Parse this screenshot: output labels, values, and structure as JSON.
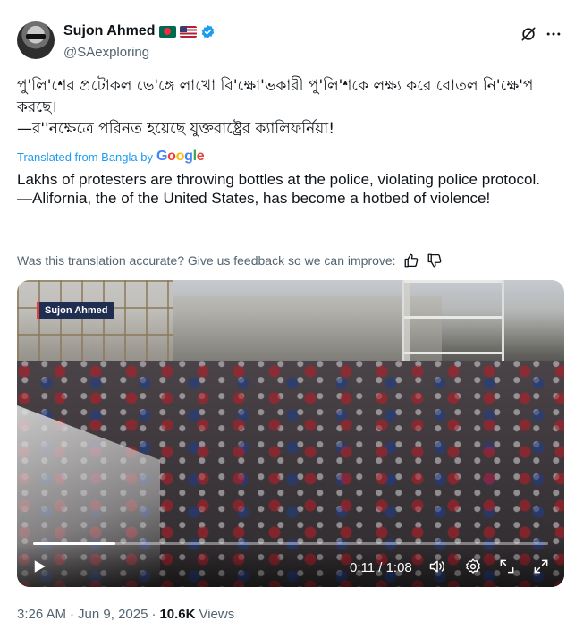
{
  "author": {
    "display_name": "Sujon Ahmed",
    "handle": "@SAexploring",
    "verified": true,
    "flags": [
      "bangladesh-flag",
      "us-flag"
    ]
  },
  "post": {
    "original_line1": "পু'লি'শের প্রটোকল ভে'ঙ্গে লাখো বি'ক্ষো'ভকারী পু'লি'শকে লক্ষ্য করে বোতল নি'ক্ষে'প করছে।",
    "original_line2": "—র''নক্ষেত্রে পরিনত হয়েছে যুক্তরাষ্ট্রের ক্যালিফর্নিয়া!",
    "translated_from_label": "Translated from Bangla by",
    "translation_provider": {
      "G": "G",
      "o1": "o",
      "o2": "o",
      "g": "g",
      "l": "l",
      "e": "e"
    },
    "translation_line1": "Lakhs of protesters are throwing bottles at the police, violating police protocol.",
    "translation_line2": "—Alifornia, the  of the United States, has become a hotbed of violence!",
    "feedback_prompt": "Was this translation accurate? Give us feedback so we can improve:"
  },
  "video": {
    "watermark": "Sujon Ahmed",
    "current_time": "0:11",
    "duration": "1:08",
    "time_display": "0:11 / 1:08",
    "progress_fraction": 0.16
  },
  "meta": {
    "time": "3:26 AM",
    "separator": "·",
    "date": "Jun 9, 2025",
    "views_count": "10.6K",
    "views_label": "Views"
  },
  "colors": {
    "link_blue": "#1d9bf0",
    "text_primary": "#0f1419",
    "text_secondary": "#536471",
    "verified_blue": "#1d9bf0"
  },
  "icons": [
    "grok-icon",
    "more-icon",
    "verified-icon",
    "thumbs-up-icon",
    "thumbs-down-icon",
    "play-icon",
    "volume-icon",
    "settings-icon",
    "minimize-icon",
    "fullscreen-icon"
  ]
}
